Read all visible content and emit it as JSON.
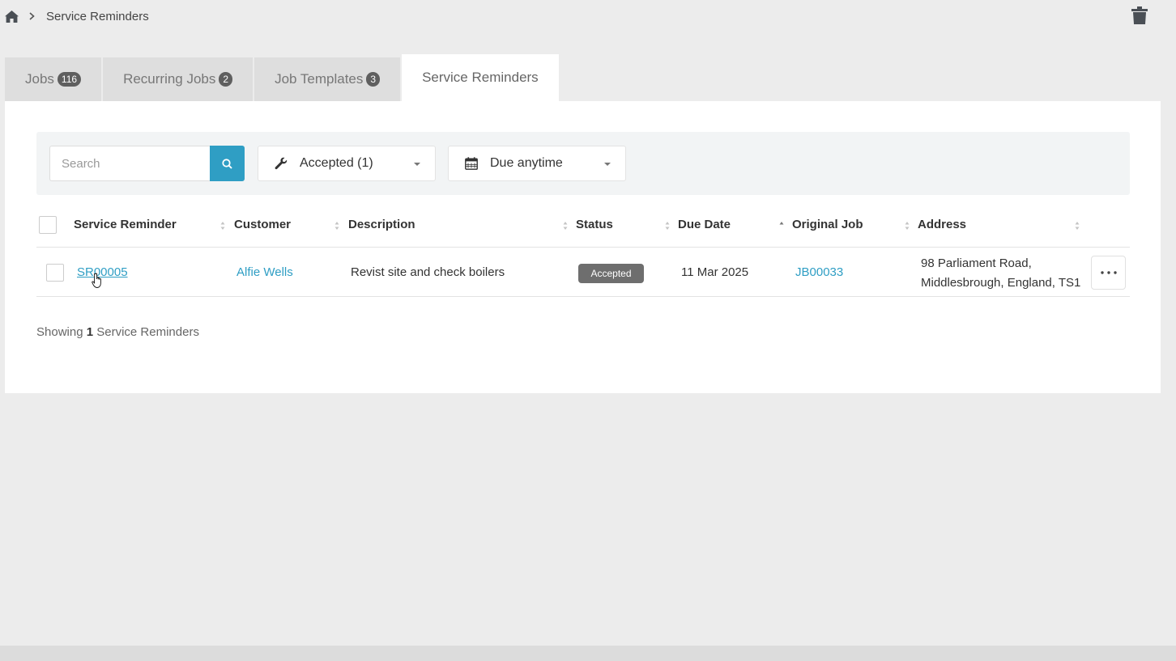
{
  "breadcrumb": {
    "home_icon": "home-icon",
    "separator_icon": "chevron-right-icon",
    "current": "Service Reminders"
  },
  "toolbar": {
    "trash_icon": "trash-icon"
  },
  "tabs": [
    {
      "label": "Jobs",
      "count": "116",
      "active": false
    },
    {
      "label": "Recurring Jobs",
      "count": "2",
      "active": false
    },
    {
      "label": "Job Templates",
      "count": "3",
      "active": false
    },
    {
      "label": "Service Reminders",
      "count": "",
      "active": true
    }
  ],
  "filters": {
    "search_placeholder": "Search",
    "search_value": "",
    "status_filter": {
      "icon": "wrench-icon",
      "selected": "Accepted (1)"
    },
    "due_filter": {
      "icon": "calendar-icon",
      "selected": "Due anytime"
    }
  },
  "table": {
    "columns": [
      "Service Reminder",
      "Customer",
      "Description",
      "Status",
      "Due Date",
      "Original Job",
      "Address"
    ],
    "sorted_column": "Due Date",
    "rows": [
      {
        "service_reminder": "SR00005",
        "customer": "Alfie Wells",
        "description": "Revist site and check boilers",
        "status": "Accepted",
        "due_date": "11 Mar 2025",
        "original_job": "JB00033",
        "address_line1": "98 Parliament Road,",
        "address_line2": "Middlesbrough, England, TS1"
      }
    ]
  },
  "footer": {
    "showing_prefix": "Showing",
    "showing_count": "1",
    "showing_suffix": "Service Reminders"
  },
  "colors": {
    "accent": "#2f9ec4",
    "badge": "#5f5f5f",
    "status_badge": "#6e6e6e",
    "page_background": "#ececec"
  }
}
